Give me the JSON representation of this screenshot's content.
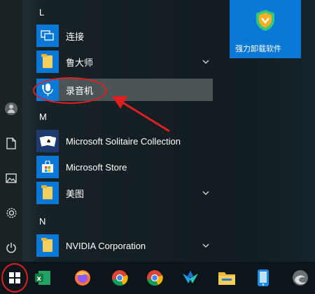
{
  "start_menu": {
    "sections": [
      {
        "letter": "L",
        "items": [
          {
            "label": "连接",
            "icon": "connect-icon",
            "tile_color": "#0a78d7",
            "expandable": false
          },
          {
            "label": "鲁大师",
            "icon": "folder-icon",
            "tile_color": "#0a78d7",
            "expandable": true
          },
          {
            "label": "录音机",
            "icon": "voice-recorder-icon",
            "tile_color": "#0a78d7",
            "expandable": false,
            "highlighted": true
          }
        ]
      },
      {
        "letter": "M",
        "items": [
          {
            "label": "Microsoft Solitaire Collection",
            "icon": "solitaire-cards-icon",
            "tile_color": "#1f3a6e",
            "expandable": false
          },
          {
            "label": "Microsoft Store",
            "icon": "store-bag-icon",
            "tile_color": "#0a78d7",
            "expandable": false
          },
          {
            "label": "美图",
            "icon": "folder-icon",
            "tile_color": "#0a78d7",
            "expandable": true
          }
        ]
      },
      {
        "letter": "N",
        "items": [
          {
            "label": "NVIDIA Corporation",
            "icon": "folder-icon",
            "tile_color": "#0a78d7",
            "expandable": true
          }
        ]
      }
    ],
    "pinned_tile": {
      "label": "强力卸载软件",
      "icon": "uninstaller-shield-icon",
      "tile_color": "#0a78d7"
    },
    "left_rail": [
      "user-avatar-icon",
      "document-icon",
      "pictures-icon",
      "settings-gear-icon",
      "power-icon"
    ]
  },
  "taskbar": {
    "start_icon": "windows-logo-icon",
    "apps": [
      "excel-icon",
      "firefox-icon",
      "chrome-icon",
      "chrome-icon",
      "app-icon",
      "file-explorer-icon",
      "phone-link-icon",
      "edge-icon"
    ]
  }
}
